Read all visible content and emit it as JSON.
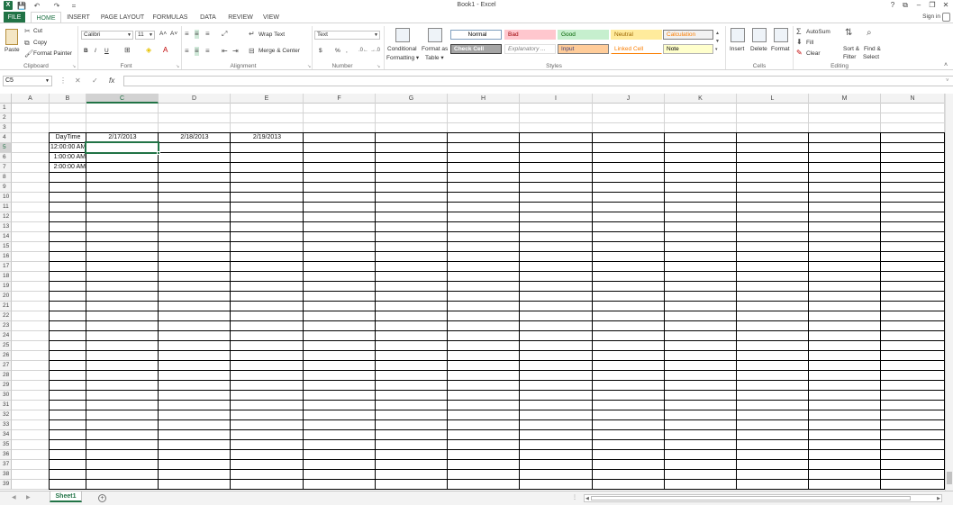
{
  "window": {
    "title": "Book1 - Excel",
    "sign_in": "Sign in",
    "help": "?",
    "restore_ribbon": "⧉",
    "minimize": "–",
    "maximize": "❐",
    "close": "✕"
  },
  "qat": {
    "save": "💾",
    "undo": "↶",
    "redo": "↷",
    "customize": "="
  },
  "tabs": [
    "FILE",
    "HOME",
    "INSERT",
    "PAGE LAYOUT",
    "FORMULAS",
    "DATA",
    "REVIEW",
    "VIEW"
  ],
  "active_tab": "HOME",
  "ribbon": {
    "clipboard": {
      "label": "Clipboard",
      "paste": "Paste",
      "cut": "Cut",
      "copy": "Copy",
      "format_painter": "Format Painter"
    },
    "font": {
      "label": "Font",
      "name": "Calibri",
      "size": "11",
      "bold": "B",
      "italic": "I",
      "underline": "U",
      "grow": "A˄",
      "shrink": "A˅"
    },
    "alignment": {
      "label": "Alignment",
      "wrap_text": "Wrap Text",
      "merge_center": "Merge & Center"
    },
    "number": {
      "label": "Number",
      "format": "Text",
      "currency": "$",
      "percent": "%",
      "comma": ","
    },
    "styles": {
      "label": "Styles",
      "conditional_formatting": [
        "Conditional",
        "Formatting ▾"
      ],
      "format_as_table": [
        "Format as",
        "Table ▾"
      ],
      "cells": [
        {
          "name": "Normal",
          "bg": "#ffffff",
          "fg": "#000000",
          "border": "#7f9fbf"
        },
        {
          "name": "Bad",
          "bg": "#ffc7ce",
          "fg": "#9c0006",
          "border": "#ffc7ce"
        },
        {
          "name": "Good",
          "bg": "#c6efce",
          "fg": "#006100",
          "border": "#c6efce"
        },
        {
          "name": "Neutral",
          "bg": "#ffeb9c",
          "fg": "#9c6500",
          "border": "#ffeb9c"
        },
        {
          "name": "Calculation",
          "bg": "#f2f2f2",
          "fg": "#fa7d00",
          "border": "#7f7f7f"
        },
        {
          "name": "Check Cell",
          "bg": "#a5a5a5",
          "fg": "#ffffff",
          "border": "#3f3f3f"
        },
        {
          "name": "Explanatory ...",
          "bg": "#ffffff",
          "fg": "#7f7f7f",
          "border": "#e0e0e0"
        },
        {
          "name": "Input",
          "bg": "#ffcc99",
          "fg": "#3f3f76",
          "border": "#7f7f7f"
        },
        {
          "name": "Linked Cell",
          "bg": "#ffffff",
          "fg": "#fa7d00",
          "border": "#ffffff"
        },
        {
          "name": "Note",
          "bg": "#ffffcc",
          "fg": "#000000",
          "border": "#b2b2b2"
        }
      ]
    },
    "cells": {
      "label": "Cells",
      "insert": "Insert",
      "delete": "Delete",
      "format": "Format"
    },
    "editing": {
      "label": "Editing",
      "autosum": "AutoSum",
      "fill": "Fill",
      "clear": "Clear",
      "sort_filter": [
        "Sort &",
        "Filter"
      ],
      "find_select": [
        "Find &",
        "Select"
      ]
    }
  },
  "formula_bar": {
    "name_box": "C5",
    "cancel": "✕",
    "enter": "✓",
    "fx": "fx",
    "value": ""
  },
  "columns": [
    "A",
    "B",
    "C",
    "D",
    "E",
    "F",
    "G",
    "H",
    "I",
    "J",
    "K",
    "L",
    "M",
    "N"
  ],
  "rows": [
    "1",
    "2",
    "3",
    "4",
    "5",
    "6",
    "7",
    "8",
    "9",
    "10",
    "11",
    "12",
    "13",
    "14",
    "15",
    "16",
    "17",
    "18",
    "19",
    "20",
    "21",
    "22",
    "23",
    "24",
    "25",
    "26",
    "27",
    "28",
    "29",
    "30",
    "31",
    "32",
    "33",
    "34",
    "35",
    "36",
    "37",
    "38",
    "39"
  ],
  "selected_cell": {
    "col": "C",
    "row": "5"
  },
  "cells": [
    {
      "ref": "B4",
      "text": "DayTime",
      "align": "center"
    },
    {
      "ref": "C4",
      "text": "2/17/2013",
      "align": "center"
    },
    {
      "ref": "D4",
      "text": "2/18/2013",
      "align": "center"
    },
    {
      "ref": "E4",
      "text": "2/19/2013",
      "align": "center"
    },
    {
      "ref": "B5",
      "text": "12:00:00 AM",
      "align": "right"
    },
    {
      "ref": "B6",
      "text": "1:00:00 AM",
      "align": "right"
    },
    {
      "ref": "B7",
      "text": "2:00:00 AM",
      "align": "right"
    }
  ],
  "sheets": [
    "Sheet1"
  ],
  "active_sheet": "Sheet1",
  "accent_color": "#217346"
}
